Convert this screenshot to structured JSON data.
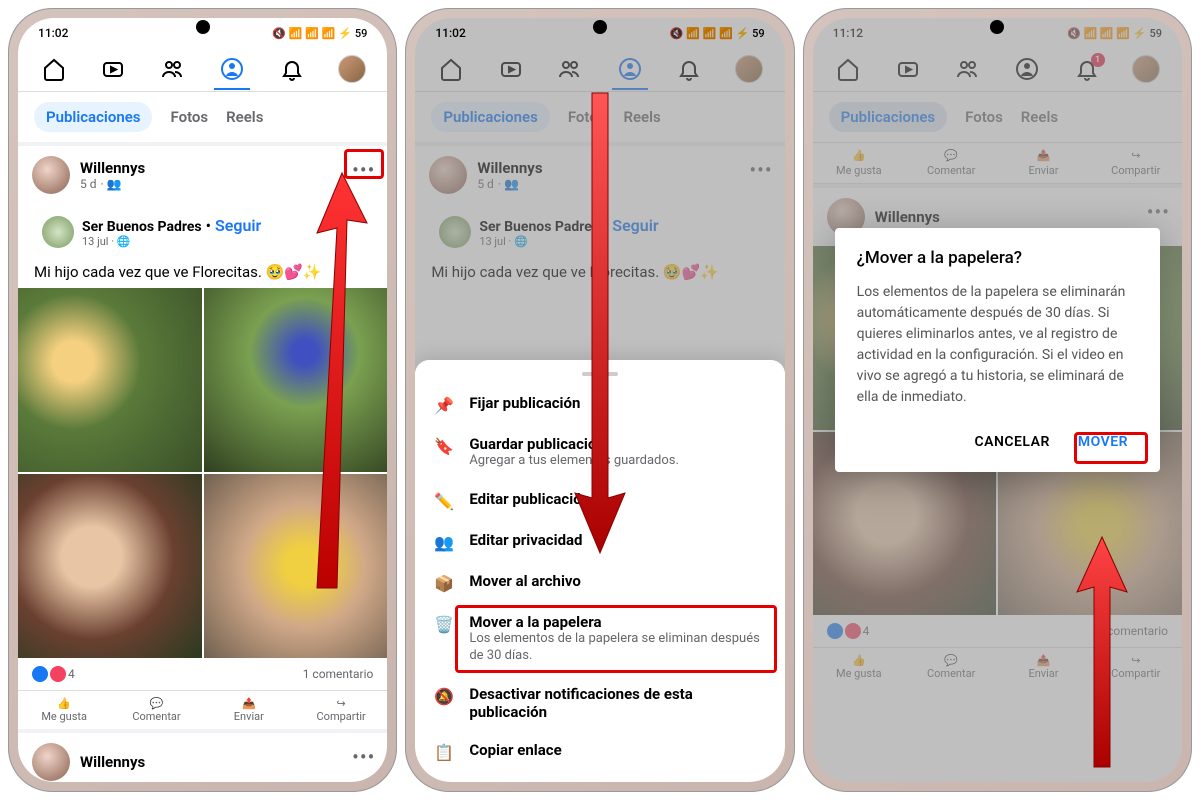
{
  "status": {
    "time1": "11:02",
    "time2": "11:02",
    "time3": "11:12",
    "battery": "59"
  },
  "tabs": {
    "posts": "Publicaciones",
    "photos": "Fotos",
    "reels": "Reels"
  },
  "engage": {
    "like": "Me gusta",
    "comment": "Comentar",
    "send": "Enviar",
    "share": "Compartir"
  },
  "post": {
    "user": "Willennys",
    "time": "5 d",
    "inner_user": "Ser Buenos Padres",
    "inner_sep": "•",
    "follow": "Seguir",
    "inner_time": "13 jul",
    "text": "Mi hijo cada vez que ve Florecitas. 🥹💕✨",
    "reactions_count": "4",
    "comments": "1 comentario"
  },
  "sheet": {
    "pin": "Fijar publicación",
    "save": "Guardar publicación",
    "save_sub": "Agregar a tus elementos guardados.",
    "edit": "Editar publicación",
    "privacy": "Editar privacidad",
    "archive": "Mover al archivo",
    "trash": "Mover a la papelera",
    "trash_sub": "Los elementos de la papelera se eliminan después de 30 días.",
    "mute": "Desactivar notificaciones de esta publicación",
    "copy": "Copiar enlace"
  },
  "dialog": {
    "title": "¿Mover a la papelera?",
    "body": "Los elementos de la papelera se eliminarán automáticamente después de 30 días. Si quieres eliminarlos antes, ve al registro de actividad en la configuración. Si el video en vivo se agregó a tu historia, se eliminará de ella de inmediato.",
    "cancel": "CANCELAR",
    "confirm": "MOVER"
  },
  "notification_badge": "1"
}
